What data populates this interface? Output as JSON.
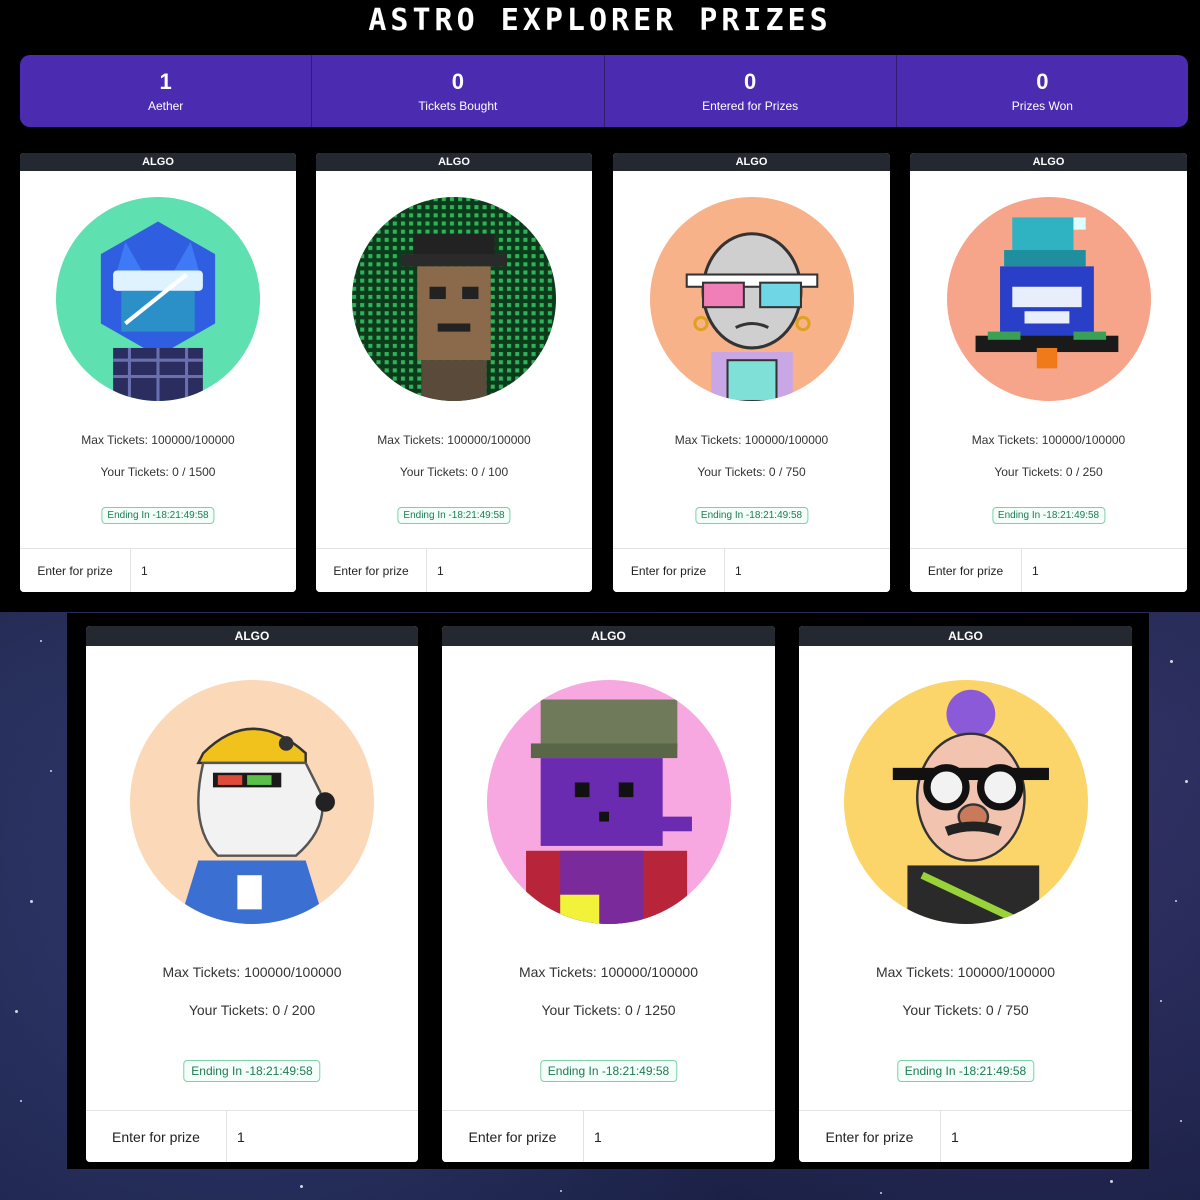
{
  "page": {
    "title": "ASTRO EXPLORER PRIZES"
  },
  "stats": [
    {
      "value": "1",
      "label": "Aether"
    },
    {
      "value": "0",
      "label": "Tickets Bought"
    },
    {
      "value": "0",
      "label": "Entered for Prizes"
    },
    {
      "value": "0",
      "label": "Prizes Won"
    }
  ],
  "cards": [
    {
      "header": "ALGO",
      "max_tickets": "Max Tickets: 100000/100000",
      "your_tickets": "Your Tickets: 0 / 1500",
      "ending": "Ending In -18:21:49:58",
      "button": "Enter for prize",
      "quantity": "1",
      "avatar": "blue-fox-astronaut-avatar",
      "bg": "#5ee0b0"
    },
    {
      "header": "ALGO",
      "max_tickets": "Max Tickets: 100000/100000",
      "your_tickets": "Your Tickets: 0 / 100",
      "ending": "Ending In -18:21:49:58",
      "button": "Enter for prize",
      "quantity": "1",
      "avatar": "matrix-pixel-portrait-avatar",
      "bg": "#0d3a1a"
    },
    {
      "header": "ALGO",
      "max_tickets": "Max Tickets: 100000/100000",
      "your_tickets": "Your Tickets: 0 / 750",
      "ending": "Ending In -18:21:49:58",
      "button": "Enter for prize",
      "quantity": "1",
      "avatar": "bald-3d-glasses-avatar",
      "bg": "#f7b28a"
    },
    {
      "header": "ALGO",
      "max_tickets": "Max Tickets: 100000/100000",
      "your_tickets": "Your Tickets: 0 / 250",
      "ending": "Ending In -18:21:49:58",
      "button": "Enter for prize",
      "quantity": "1",
      "avatar": "pixel-beanie-creature-avatar",
      "bg": "#f6a48a"
    },
    {
      "header": "ALGO",
      "max_tickets": "Max Tickets: 100000/100000",
      "your_tickets": "Your Tickets: 0 / 200",
      "ending": "Ending In -18:21:49:58",
      "button": "Enter for prize",
      "quantity": "1",
      "avatar": "miner-dog-avatar",
      "bg": "#fbd8b8"
    },
    {
      "header": "ALGO",
      "max_tickets": "Max Tickets: 100000/100000",
      "your_tickets": "Your Tickets: 0 / 1250",
      "ending": "Ending In -18:21:49:58",
      "button": "Enter for prize",
      "quantity": "1",
      "avatar": "purple-pixel-alien-avatar",
      "bg": "#f7a8e0"
    },
    {
      "header": "ALGO",
      "max_tickets": "Max Tickets: 100000/100000",
      "your_tickets": "Your Tickets: 0 / 750",
      "ending": "Ending In -18:21:49:58",
      "button": "Enter for prize",
      "quantity": "1",
      "avatar": "disguise-glasses-avatar",
      "bg": "#fbd46a"
    }
  ],
  "colors": {
    "accent": "#4b2bb0",
    "card_header": "#232831",
    "ending_green": "#1f7a52"
  }
}
